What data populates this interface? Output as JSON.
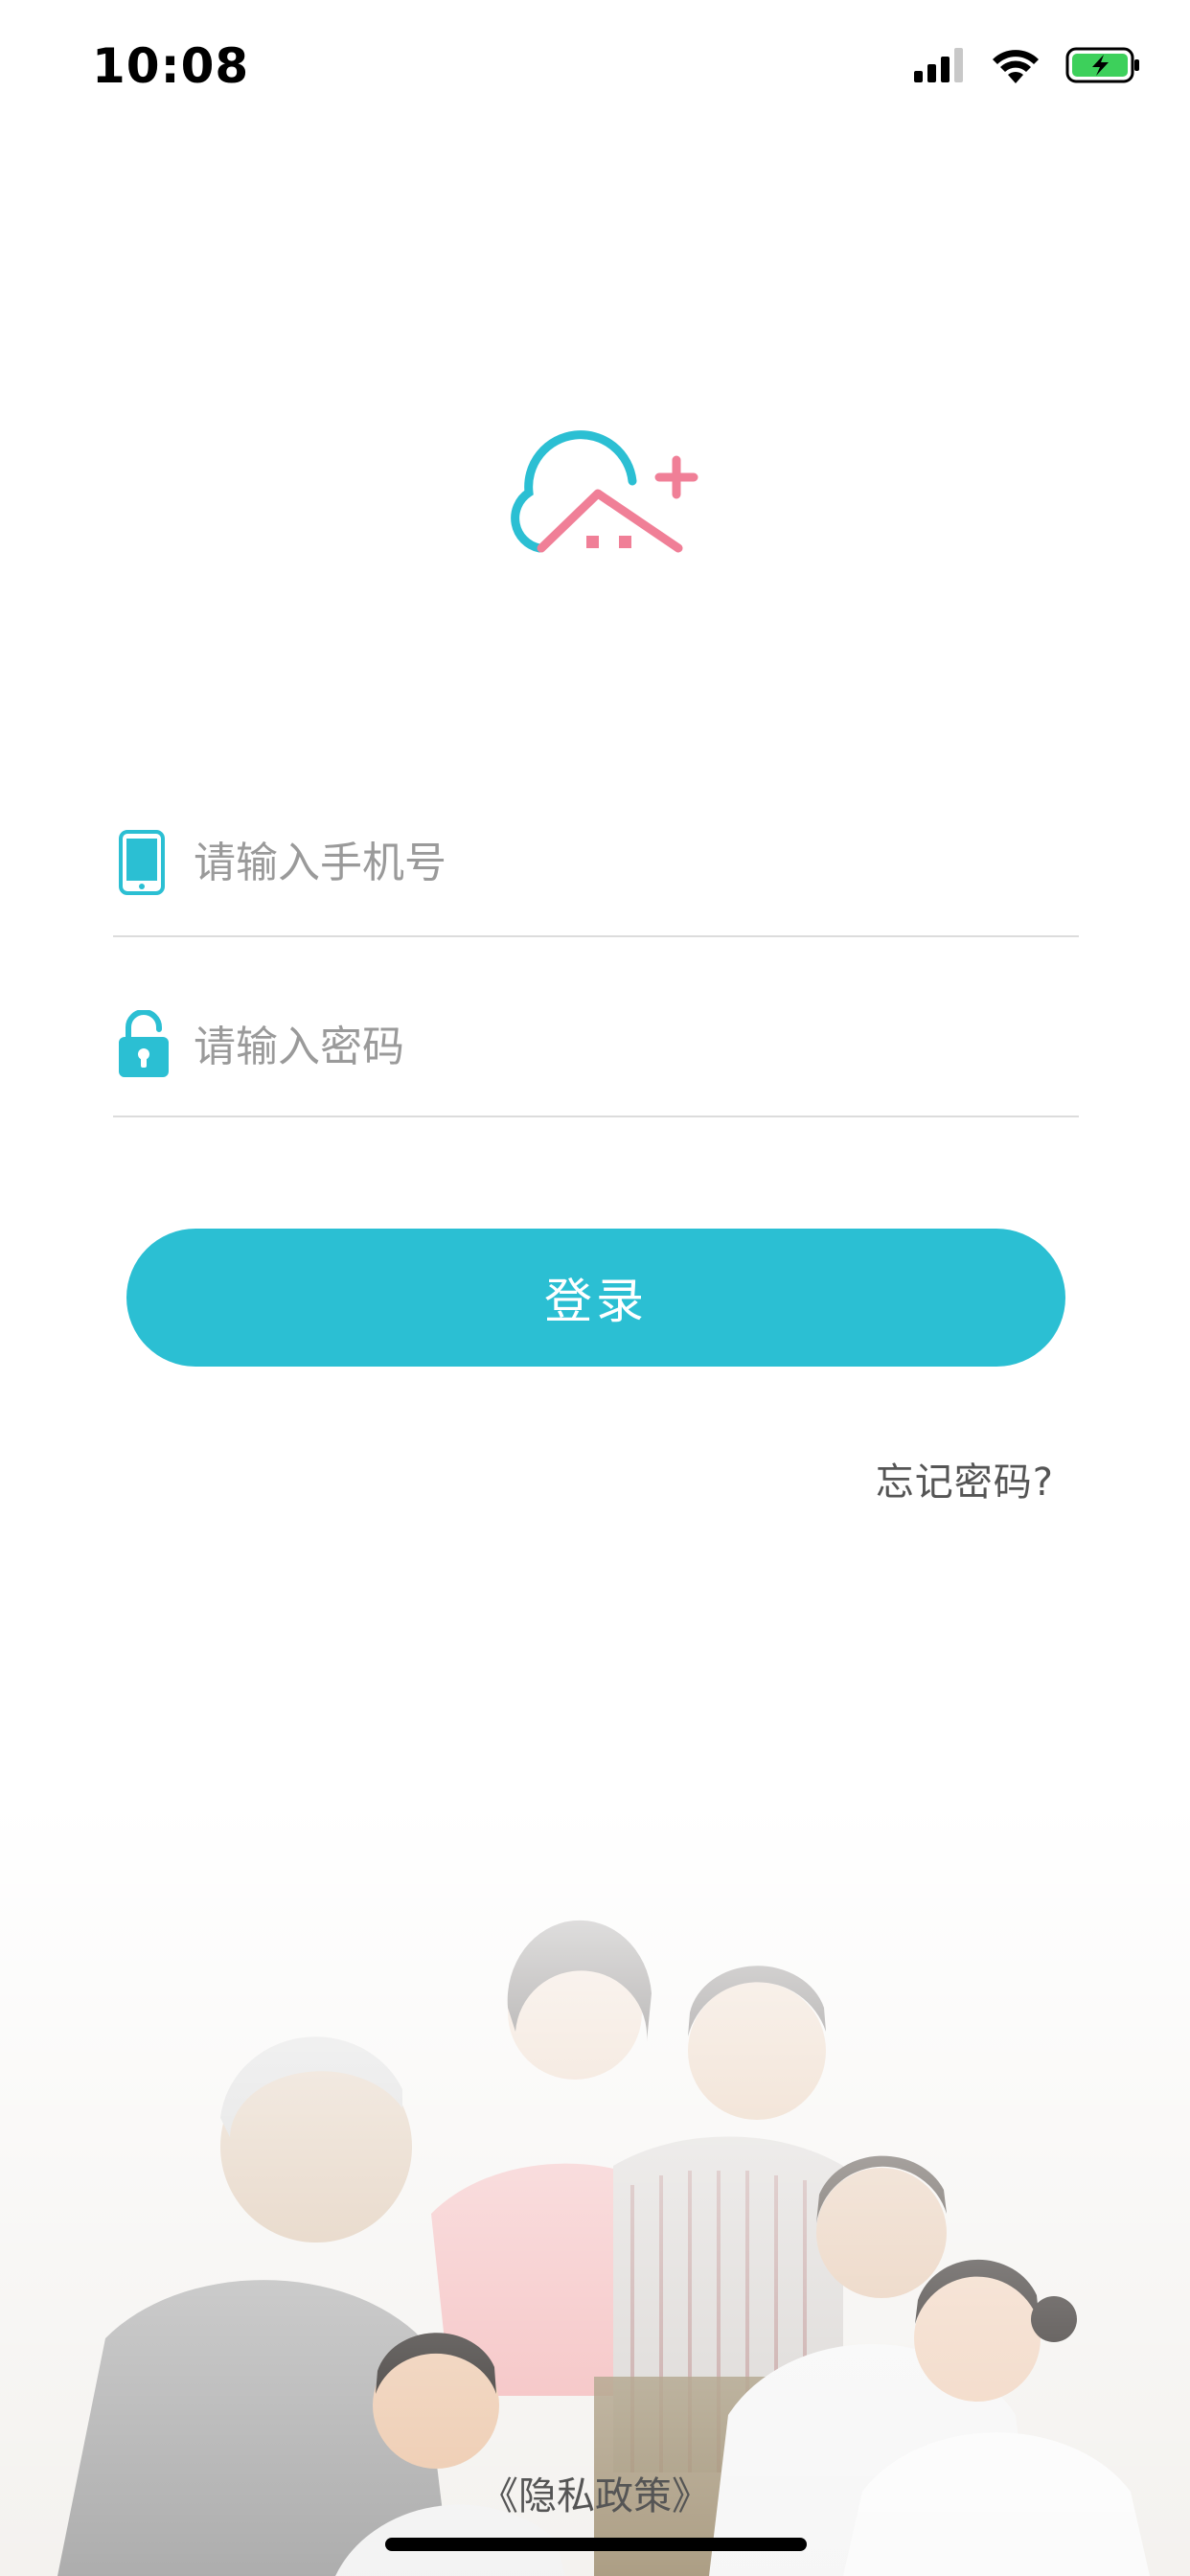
{
  "status_bar": {
    "time": "10:08",
    "icons": [
      "cellular-signal-icon",
      "wifi-icon",
      "battery-charging-icon"
    ]
  },
  "logo": {
    "icon": "cloud-home-plus-logo",
    "colors": {
      "cloud": "#2bbfd3",
      "house": "#f07f97"
    }
  },
  "phone_field": {
    "icon": "mobile-phone-icon",
    "placeholder": "请输入手机号",
    "value": ""
  },
  "password_field": {
    "icon": "unlocked-padlock-icon",
    "placeholder": "请输入密码",
    "value": ""
  },
  "login_button": {
    "label": "登录",
    "color": "#2bbfd3"
  },
  "forgot_password": {
    "label": "忘记密码?"
  },
  "privacy_link": {
    "label": "《隐私政策》"
  },
  "background": {
    "image": "family-photo",
    "description_visible": false
  }
}
